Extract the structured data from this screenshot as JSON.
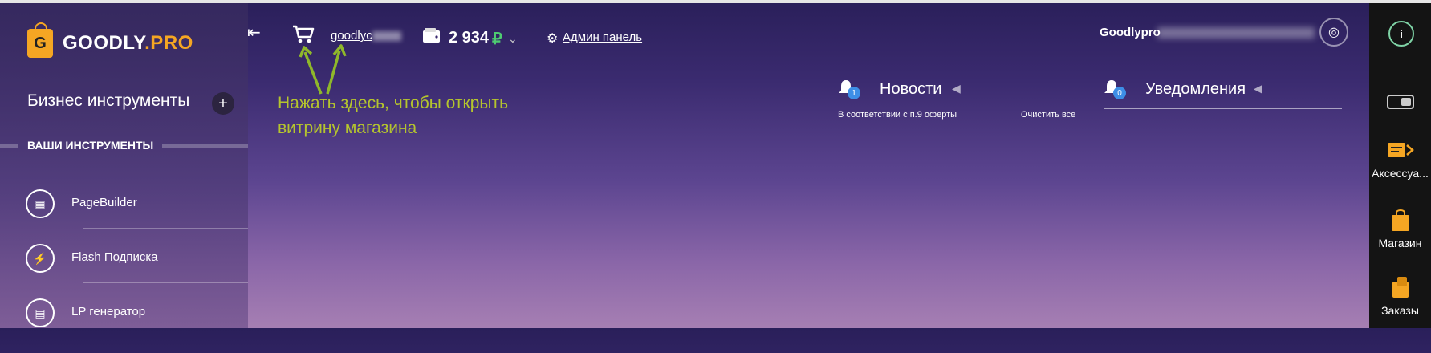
{
  "logo": {
    "letter": "G",
    "text_main": "GOODLY",
    "text_accent": ".PRO"
  },
  "sidebar": {
    "title": "Бизнес инструменты",
    "add_label": "+",
    "section_label": "ВАШИ ИНСТРУМЕНТЫ",
    "tools": [
      {
        "label": "PageBuilder",
        "icon": "pagebuilder-icon"
      },
      {
        "label": "Flash Подписка",
        "icon": "flash-subscription-icon"
      },
      {
        "label": "LP генератор",
        "icon": "lp-generator-icon"
      }
    ]
  },
  "header": {
    "store_link_text": "goodlyc",
    "balance": "2 934",
    "currency": "₽",
    "admin_label": "Админ панель"
  },
  "annotation": "Нажать здесь, чтобы открыть витрину магазина",
  "user": {
    "name": "Goodlypro"
  },
  "news": {
    "title": "Новости",
    "badge": "1",
    "note_left": "В соответствии с п.9 оферты",
    "note_right": "Очистить все"
  },
  "notifications": {
    "title": "Уведомления",
    "badge": "0"
  },
  "rightbar": {
    "info_label": "i",
    "items": [
      {
        "label": "Аксессуа...",
        "icon": "accessories-icon"
      },
      {
        "label": "Магазин",
        "icon": "shop-bag-icon"
      },
      {
        "label": "Заказы",
        "icon": "orders-icon"
      }
    ]
  },
  "colors": {
    "accent": "#f5a623",
    "annotation": "#b5c52d",
    "ruble": "#4ecb71",
    "badge": "#3d8ee6"
  }
}
